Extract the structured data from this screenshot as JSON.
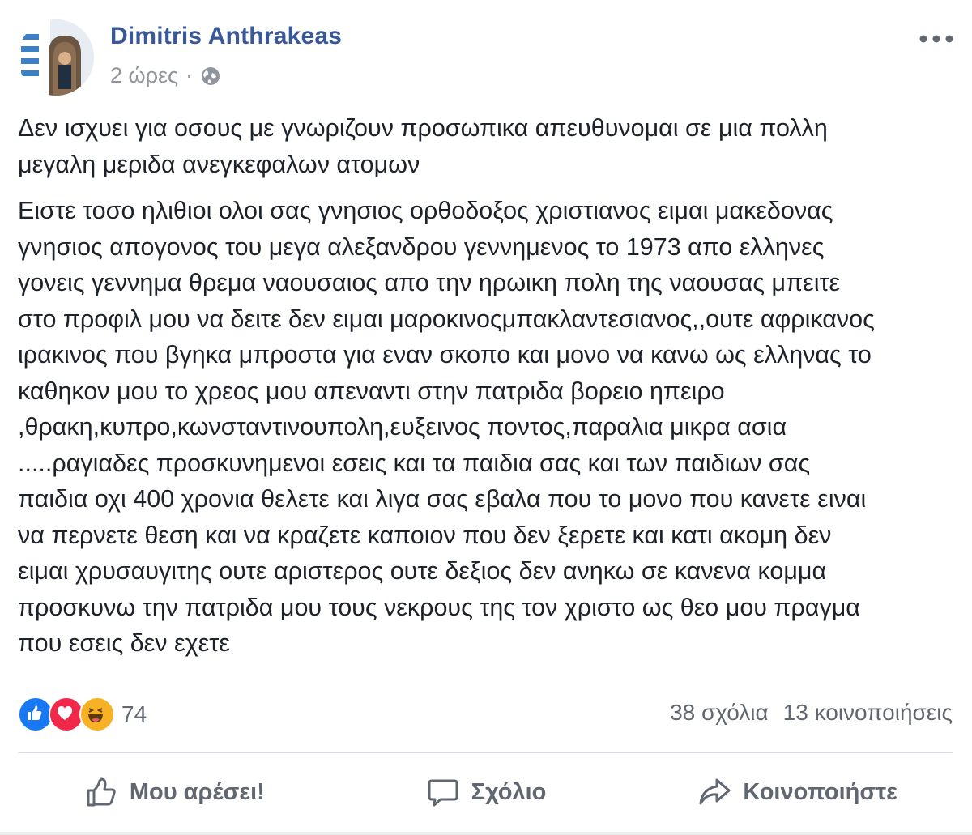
{
  "post": {
    "author": "Dimitris Anthrakeas",
    "time": "2 ώρες",
    "separator": "·",
    "privacy_icon": "globe-icon",
    "more_icon": "more-options-icon",
    "paragraphs": [
      "Δεν ισχυει για οσους με γνωριζουν προσωπικα απευθυνομαι σε μια πολλη\nμεγαλη μεριδα ανεγκεφαλων ατομων",
      "Ειστε τοσο ηλιθιοι ολοι σας γνησιος ορθοδοξος χριστιανος ειμαι μακεδονας\nγνησιος απογονος του μεγα αλεξανδρου γεννημενος το 1973 απο ελληνες\nγονεις γεννημα θρεμα ναουσαιος απο την ηρωικη πολη της ναουσας μπειτε\nστο προφιλ μου να δειτε δεν ειμαι μαροκινοςμπακλαντεσιανος,,ουτε αφρικανος\nιρακινος που βγηκα μπροστα για εναν σκοπο και μονο να κανω ως ελληνας το\nκαθηκον μου το χρεος μου απεναντι στην πατριδα βορειο ηπειρο\n,θρακη,κυπρο,κωνσταντινουπολη,ευξεινος ποντος,παραλια μικρα ασια\n.....ραγιαδες προσκυνημενοι εσεις και τα παιδια σας και των παιδιων σας\nπαιδια οχι 400 χρονια θελετε και λιγα σας εβαλα που το μονο που κανετε ειναι\nνα περνετε θεση και να κραζετε καποιον που δεν ξερετε και κατι ακομη δεν\nειμαι χρυσαυγιτης ουτε αριστερος ουτε δεξιος δεν ανηκω σε κανενα κομμα\nπροσκυνω την πατριδα μου τους νεκρους της τον χριστο ως θεο μου πραγμα\nπου εσεις δεν εχετε"
    ]
  },
  "reactions": {
    "icons": [
      "like-reaction-icon",
      "love-reaction-icon",
      "haha-reaction-icon"
    ],
    "count": "74",
    "like_color": "#1877f2",
    "love_color": "#f0284a",
    "haha_color": "#f7b125"
  },
  "stats": {
    "comments": "38 σχόλια",
    "shares": "13 κοινοποιήσεις"
  },
  "actions": {
    "like": "Μου αρέσει!",
    "comment": "Σχόλιο",
    "share": "Κοινοποιήστε"
  },
  "colors": {
    "author": "#385898",
    "meta": "#90949c",
    "text": "#1d2129",
    "secondary": "#606770",
    "divider": "#dadde1"
  }
}
